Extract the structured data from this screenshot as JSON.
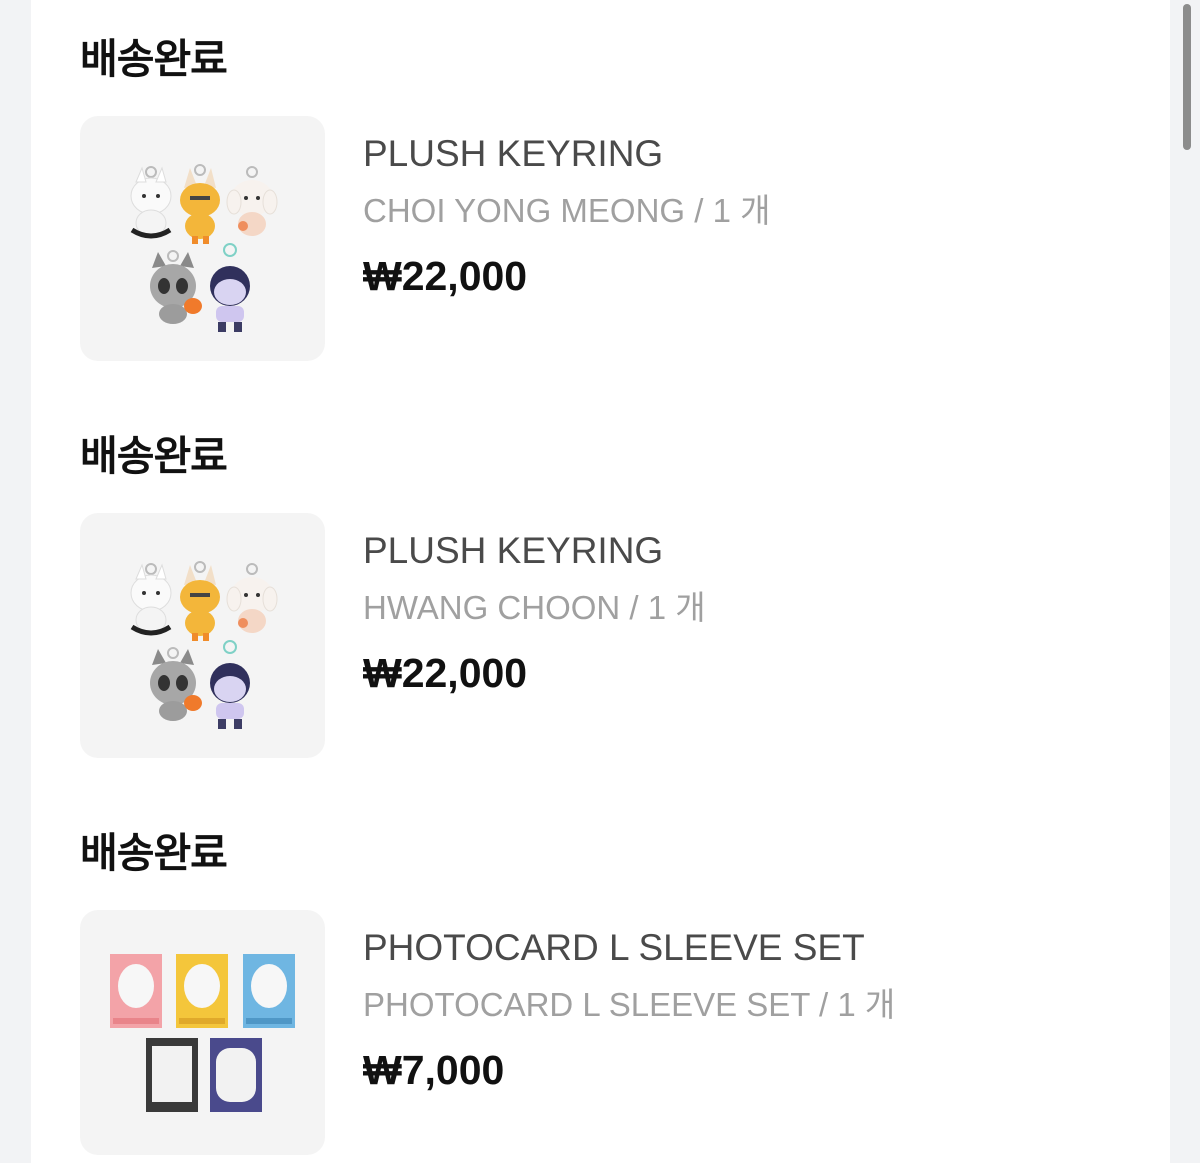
{
  "orders": [
    {
      "status": "배송완료",
      "product_name": "PLUSH KEYRING",
      "option": "CHOI YONG MEONG / 1 개",
      "price": "₩22,000",
      "image_icon": "plush-keyring-image"
    },
    {
      "status": "배송완료",
      "product_name": "PLUSH KEYRING",
      "option": "HWANG CHOON / 1 개",
      "price": "₩22,000",
      "image_icon": "plush-keyring-image"
    },
    {
      "status": "배송완료",
      "product_name": "PHOTOCARD L SLEEVE SET",
      "option": "PHOTOCARD L SLEEVE SET / 1 개",
      "price": "₩7,000",
      "image_icon": "photocard-sleeve-image"
    }
  ]
}
